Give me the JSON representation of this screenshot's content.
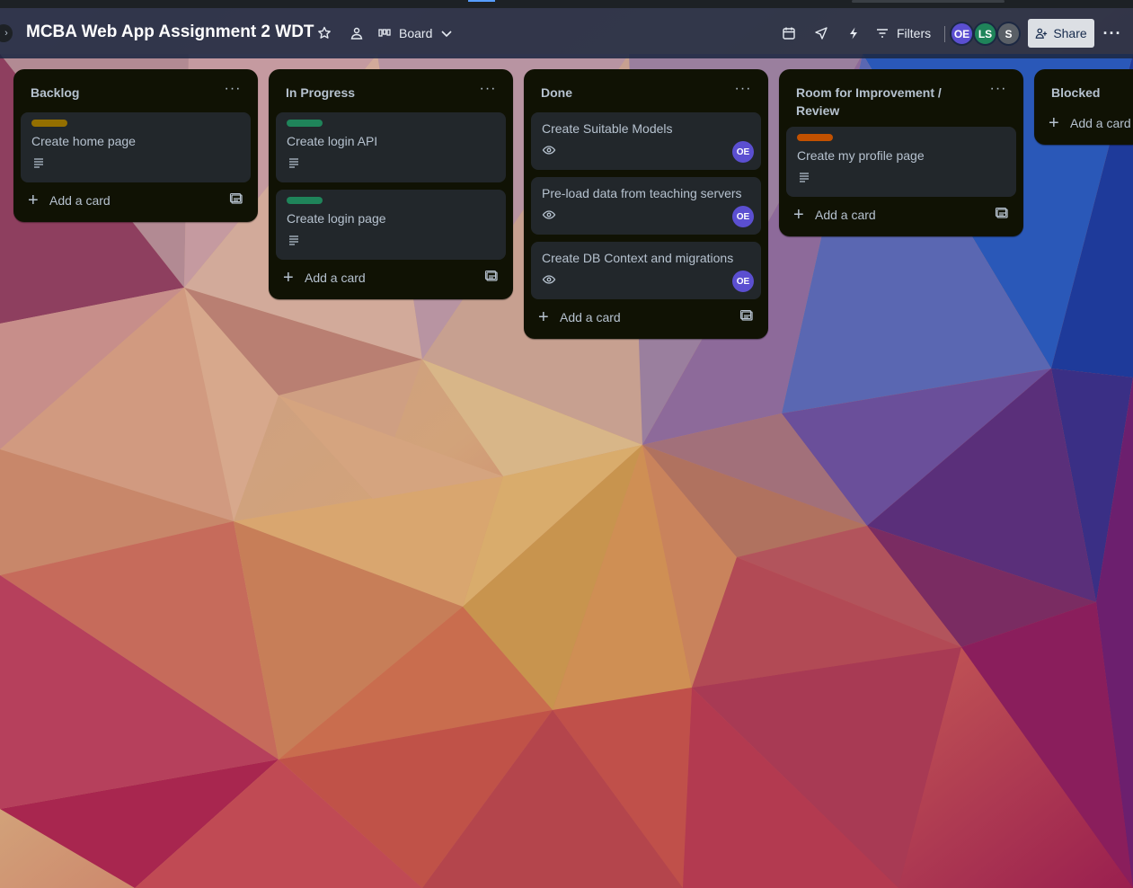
{
  "header": {
    "board_title": "MCBA Web App Assignment 2 WDT",
    "view_label": "Board",
    "filters_label": "Filters",
    "share_label": "Share",
    "members": [
      {
        "initials": "OE",
        "color": "#5b4fd1"
      },
      {
        "initials": "LS",
        "color": "#1f845a"
      },
      {
        "initials": "S",
        "color": "#5a5f66"
      }
    ]
  },
  "lists": [
    {
      "title": "Backlog",
      "cards": [
        {
          "title": "Create home page",
          "label_color": "#946f00",
          "has_description": true
        }
      ],
      "add_label": "Add a card"
    },
    {
      "title": "In Progress",
      "cards": [
        {
          "title": "Create login API",
          "label_color": "#1f845a",
          "has_description": true
        },
        {
          "title": "Create login page",
          "label_color": "#1f845a",
          "has_description": true
        }
      ],
      "add_label": "Add a card"
    },
    {
      "title": "Done",
      "cards": [
        {
          "title": "Create Suitable Models",
          "watching": true,
          "member": "OE"
        },
        {
          "title": "Pre-load data from teaching servers",
          "watching": true,
          "member": "OE"
        },
        {
          "title": "Create DB Context and migrations",
          "watching": true,
          "member": "OE"
        }
      ],
      "add_label": "Add a card"
    },
    {
      "title": "Room for Improvement / Review",
      "cards": [
        {
          "title": "Create my profile page",
          "label_color": "#c25100",
          "has_description": true
        }
      ],
      "add_label": "Add a card"
    },
    {
      "title": "Blocked",
      "cards": [],
      "add_label": "Add a card"
    }
  ]
}
